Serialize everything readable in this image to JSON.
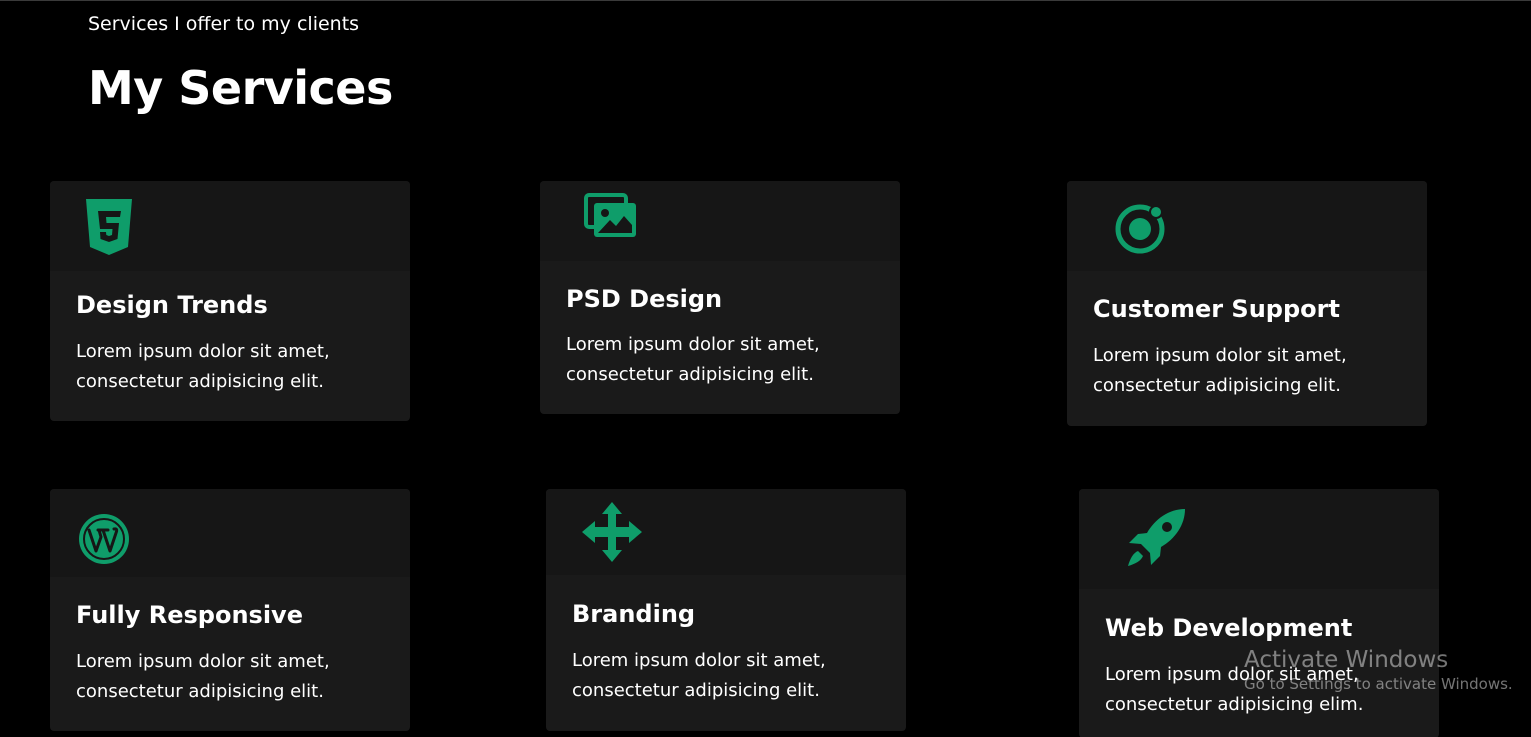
{
  "header": {
    "subtitle": "Services I offer to my clients",
    "title": "My Services"
  },
  "accent_color": "#0f9d6a",
  "cards": [
    {
      "icon": "css3-icon",
      "title": "Design Trends",
      "line1": "Lorem ipsum dolor sit amet,",
      "line2": "consectetur adipisicing elit."
    },
    {
      "icon": "images-icon",
      "title": "PSD Design",
      "line1": "Lorem ipsum dolor sit amet,",
      "line2": "consectetur adipisicing elit."
    },
    {
      "icon": "ionic-icon",
      "title": "Customer Support",
      "line1": "Lorem ipsum dolor sit amet,",
      "line2": "consectetur adipisicing elit."
    },
    {
      "icon": "wordpress-icon",
      "title": "Fully Responsive",
      "line1": "Lorem ipsum dolor sit amet,",
      "line2": "consectetur adipisicing elit."
    },
    {
      "icon": "move-arrows-icon",
      "title": "Branding",
      "line1": "Lorem ipsum dolor sit amet,",
      "line2": "consectetur adipisicing elit."
    },
    {
      "icon": "rocket-icon",
      "title": "Web Development",
      "line1": "Lorem ipsum dolor sit amet,",
      "line2": "consectetur adipisicing elim."
    }
  ],
  "watermark": {
    "title": "Activate Windows",
    "subtitle": "Go to Settings to activate Windows."
  }
}
